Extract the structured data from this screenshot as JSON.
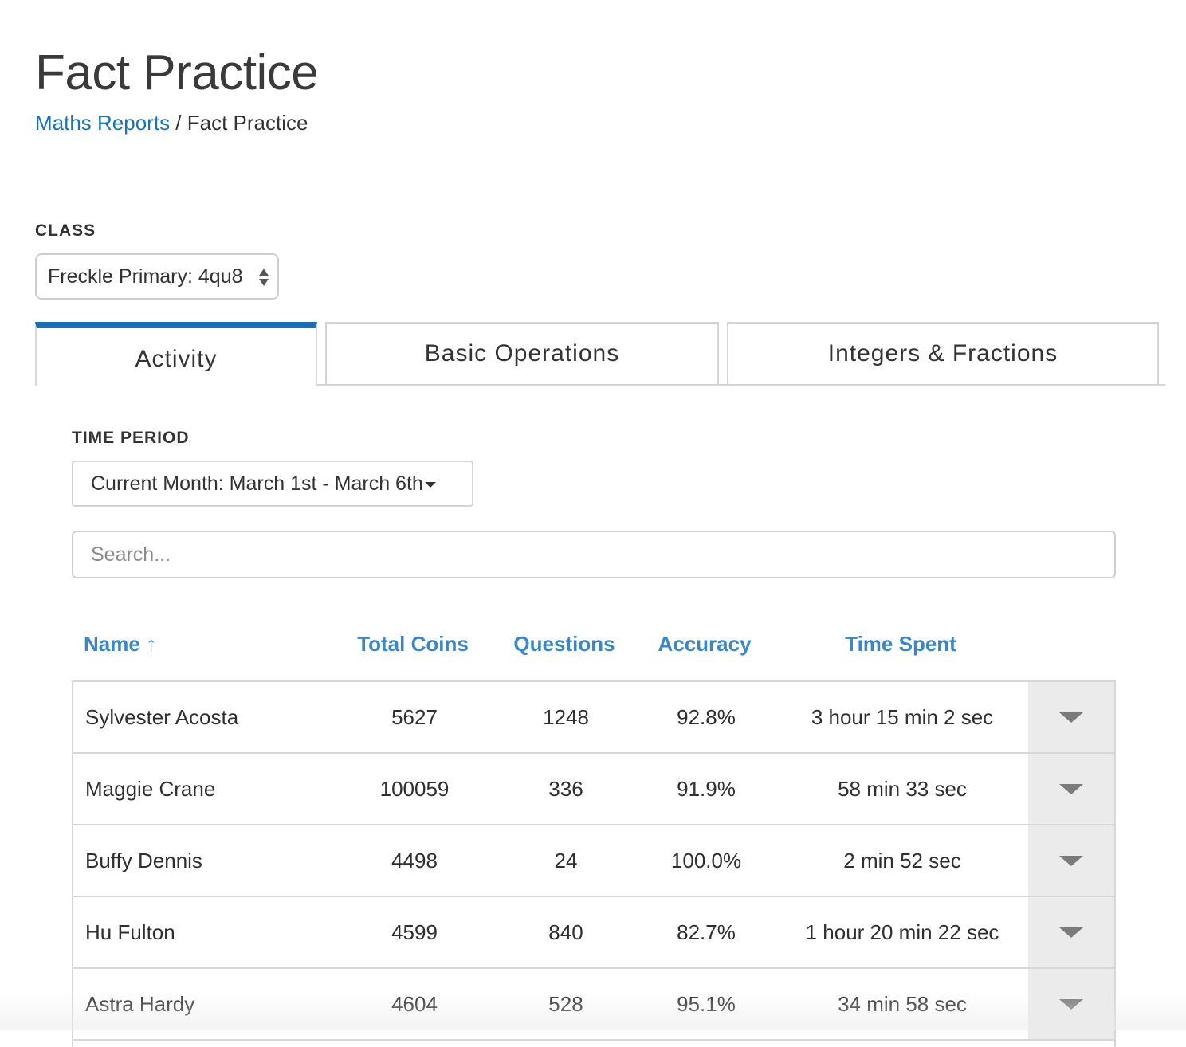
{
  "page": {
    "title": "Fact Practice",
    "breadcrumb": {
      "parent": "Maths Reports",
      "separator": " / ",
      "current": "Fact Practice"
    }
  },
  "class_filter": {
    "label": "CLASS",
    "selected": "Freckle Primary: 4qu8"
  },
  "tabs": [
    {
      "label": "Activity",
      "active": true
    },
    {
      "label": "Basic Operations",
      "active": false
    },
    {
      "label": "Integers & Fractions",
      "active": false
    }
  ],
  "time_period": {
    "label": "TIME PERIOD",
    "selected": "Current Month: March 1st - March 6th"
  },
  "search": {
    "placeholder": "Search...",
    "value": ""
  },
  "table": {
    "headers": {
      "name": "Name",
      "sort_indicator": "↑",
      "total_coins": "Total Coins",
      "questions": "Questions",
      "accuracy": "Accuracy",
      "time_spent": "Time Spent"
    },
    "rows": [
      {
        "name": "Sylvester Acosta",
        "total_coins": "5627",
        "questions": "1248",
        "accuracy": "92.8%",
        "time_spent": "3 hour 15 min 2 sec"
      },
      {
        "name": "Maggie Crane",
        "total_coins": "100059",
        "questions": "336",
        "accuracy": "91.9%",
        "time_spent": "58 min 33 sec"
      },
      {
        "name": "Buffy Dennis",
        "total_coins": "4498",
        "questions": "24",
        "accuracy": "100.0%",
        "time_spent": "2 min 52 sec"
      },
      {
        "name": "Hu Fulton",
        "total_coins": "4599",
        "questions": "840",
        "accuracy": "82.7%",
        "time_spent": "1 hour 20 min 22 sec"
      },
      {
        "name": "Astra Hardy",
        "total_coins": "4604",
        "questions": "528",
        "accuracy": "95.1%",
        "time_spent": "34 min 58 sec"
      }
    ]
  },
  "colors": {
    "link": "#1a73b5",
    "header_text": "#3a86c8",
    "active_tab_accent": "#1a6fb5",
    "expand_bg": "#ebebeb"
  },
  "icons": {
    "class_select": "up-down-arrows-icon",
    "period_select": "caret-down-icon",
    "row_expand": "triangle-down-icon"
  }
}
